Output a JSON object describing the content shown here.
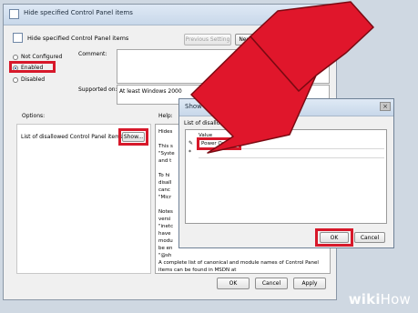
{
  "window": {
    "title": "Hide specified Control Panel items",
    "subtitle": "Hide specified Control Panel items",
    "prev_setting": "Previous Setting",
    "next_setting": "Next Setting"
  },
  "radios": [
    {
      "label": "Not Configured",
      "selected": false
    },
    {
      "label": "Enabled",
      "selected": true
    },
    {
      "label": "Disabled",
      "selected": false
    }
  ],
  "comment_label": "Comment:",
  "supported_label": "Supported on:",
  "supported_value": "At least Windows 2000",
  "options_label": "Options:",
  "help_label": "Help:",
  "option_item": "List of disallowed Control Panel items",
  "show_button": "Show...",
  "help_lines": [
    "Hides",
    "This s",
    "\"Syste",
    "and t",
    "To hi",
    "disall",
    "canc",
    "\"Micr",
    "Notes",
    "versi",
    "\"inetc",
    "have",
    "modu",
    "be en",
    "\"@sh"
  ],
  "help_bottom": [
    "A complete list of canonical and module names of Control Panel",
    "items can be found in MSDN at"
  ],
  "main_buttons": {
    "ok": "OK",
    "cancel": "Cancel",
    "apply": "Apply"
  },
  "dialog": {
    "title": "Show Contents",
    "close": "×",
    "list_label": "List of disallowed Control P",
    "column": "Value",
    "rows": [
      {
        "marker": "✎",
        "value": "Power Options"
      },
      {
        "marker": "*",
        "value": ""
      }
    ],
    "ok": "OK",
    "cancel": "Cancel"
  },
  "watermark": {
    "a": "wiki",
    "b": "How"
  },
  "colors": {
    "highlight": "#d7182a",
    "arrow": "#e0162b"
  }
}
